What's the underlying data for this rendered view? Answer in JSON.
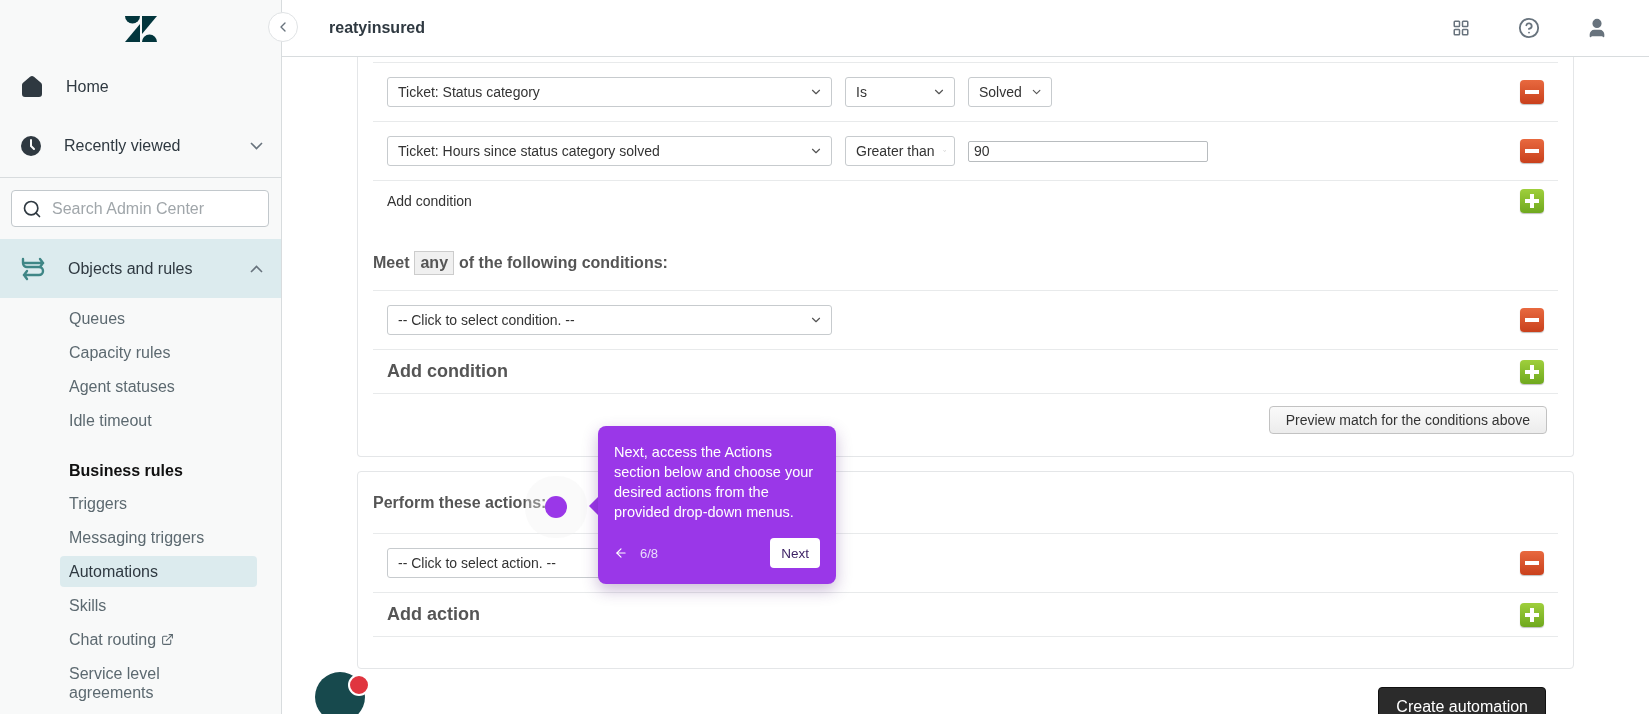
{
  "sidebar": {
    "items": [
      {
        "label": "Home",
        "kind": "home"
      },
      {
        "label": "Recently viewed",
        "kind": "recent",
        "expanded": false
      }
    ],
    "search": {
      "placeholder": "Search Admin Center"
    },
    "section": {
      "label": "Objects and rules",
      "expanded": true,
      "selected": true,
      "groups": [
        {
          "items": [
            {
              "label": "Queues",
              "selected": false,
              "external": false
            },
            {
              "label": "Capacity rules",
              "selected": false,
              "external": false
            },
            {
              "label": "Agent statuses",
              "selected": false,
              "external": false
            },
            {
              "label": "Idle timeout",
              "selected": false,
              "external": false
            }
          ]
        },
        {
          "heading": "Business rules",
          "items": [
            {
              "label": "Triggers",
              "selected": false,
              "external": false
            },
            {
              "label": "Messaging triggers",
              "selected": false,
              "external": false
            },
            {
              "label": "Automations",
              "selected": true,
              "external": false
            },
            {
              "label": "Skills",
              "selected": false,
              "external": false
            },
            {
              "label": "Chat routing",
              "selected": false,
              "external": true
            },
            {
              "label": "Service level agreements",
              "selected": false,
              "external": false
            }
          ]
        }
      ]
    }
  },
  "header": {
    "title": "reatyinsured"
  },
  "all_conditions": {
    "rows": [
      {
        "field": "Ticket: Status category",
        "operator": "Is",
        "value": {
          "kind": "select",
          "text": "Solved"
        }
      },
      {
        "field": "Ticket: Hours since status category solved",
        "operator": "Greater than",
        "value": {
          "kind": "input",
          "text": "90"
        }
      }
    ],
    "add_label": "Add condition"
  },
  "any_conditions": {
    "heading_before": "Meet",
    "match": "any",
    "heading_after": "of the following conditions:",
    "rows": [
      {
        "field": "-- Click to select condition. --"
      }
    ],
    "add_label": "Add condition",
    "preview_button": "Preview match for the conditions above"
  },
  "actions": {
    "heading": "Perform these actions:",
    "rows": [
      {
        "field": "-- Click to select action. --"
      }
    ],
    "add_label": "Add action"
  },
  "footer": {
    "create_button": "Create automation"
  },
  "tour": {
    "text": "Next, access the Actions section below and choose your desired actions from the provided drop-down menus.",
    "step": "6/8",
    "next": "Next"
  }
}
